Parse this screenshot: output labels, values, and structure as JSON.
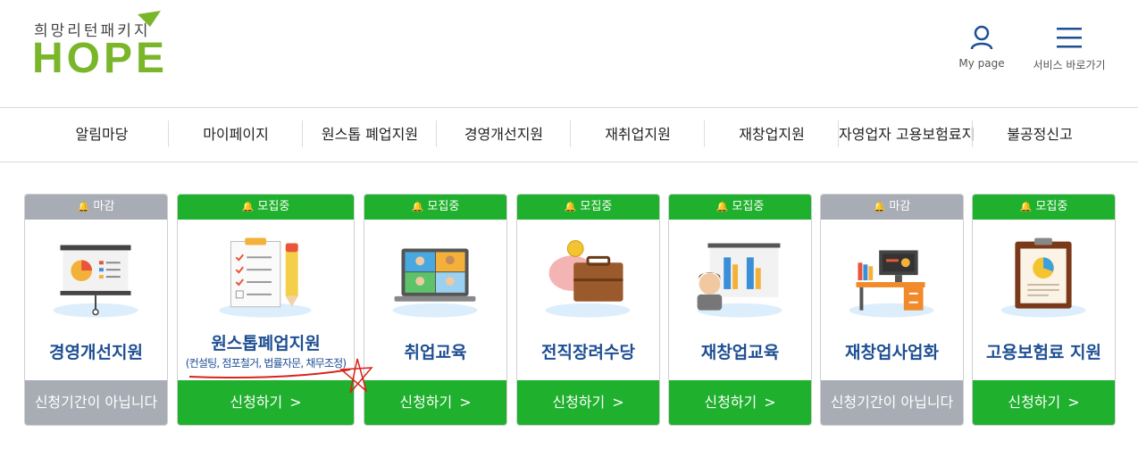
{
  "brand": {
    "sub": "희망리턴패키지",
    "main": "HOPE",
    "green": "#7ab62a"
  },
  "utility": {
    "mypage_label": "My page",
    "menu_label": "서비스 바로가기"
  },
  "nav": {
    "items": [
      "알림마당",
      "마이페이지",
      "원스톱 폐업지원",
      "경영개선지원",
      "재취업지원",
      "재창업지원",
      "자영업자 고용보험료지",
      "불공정신고"
    ]
  },
  "colors": {
    "open": "#1fb02d",
    "closed": "#a7acb5",
    "title": "#1e4f93"
  },
  "cards": [
    {
      "status": "마감",
      "title": "경영개선지원",
      "note": "",
      "button": "신청기간이 아닙니다",
      "icon": "presentation-board-icon"
    },
    {
      "status": "모집중",
      "title": "원스톱폐업지원",
      "note": "(컨설팅, 점포철거, 법률자문, 채무조정)",
      "button": "신청하기",
      "icon": "checklist-pencil-icon"
    },
    {
      "status": "모집중",
      "title": "취업교육",
      "note": "",
      "button": "신청하기",
      "icon": "video-meeting-laptop-icon"
    },
    {
      "status": "모집중",
      "title": "전직장려수당",
      "note": "",
      "button": "신청하기",
      "icon": "piggy-bank-briefcase-icon"
    },
    {
      "status": "모집중",
      "title": "재창업교육",
      "note": "",
      "button": "신청하기",
      "icon": "presenter-chart-icon"
    },
    {
      "status": "마감",
      "title": "재창업사업화",
      "note": "",
      "button": "신청기간이 아닙니다",
      "icon": "office-desk-icon"
    },
    {
      "status": "모집중",
      "title": "고용보험료 지원",
      "note": "",
      "button": "신청하기",
      "icon": "clipboard-report-icon"
    }
  ]
}
